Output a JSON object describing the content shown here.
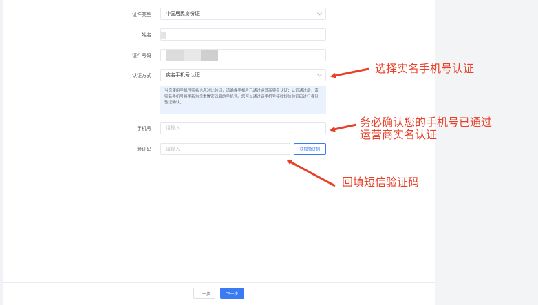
{
  "form": {
    "id_type": {
      "label": "证件类型",
      "value": "中国居民身份证"
    },
    "name": {
      "label": "姓名"
    },
    "id_number": {
      "label": "证件号码"
    },
    "auth_method": {
      "label": "认证方式",
      "value": "实名手机号认证"
    },
    "notice": "当您使用手机号实名信息对比验证，请确保手机号已通过运营商实名认证；认证通过后，该实名手机号将更新为您重置密码后的手机号。您可以通过该手机号接收短信验证码进行身份验证确认；",
    "phone": {
      "label": "手机号",
      "placeholder": "请输入"
    },
    "code": {
      "label": "验证码",
      "placeholder": "请输入"
    },
    "get_code_label": "获取验证码"
  },
  "footer": {
    "prev_label": "上一步",
    "next_label": "下一步"
  },
  "annotations": {
    "a1": "选择实名手机号认证",
    "a2_line1": "务必确认您的手机号已通过",
    "a2_line2": "运营商实名认证",
    "a3": "回填短信验证码"
  },
  "colors": {
    "accent": "#3a7bf4",
    "annotation": "#e8412a"
  }
}
